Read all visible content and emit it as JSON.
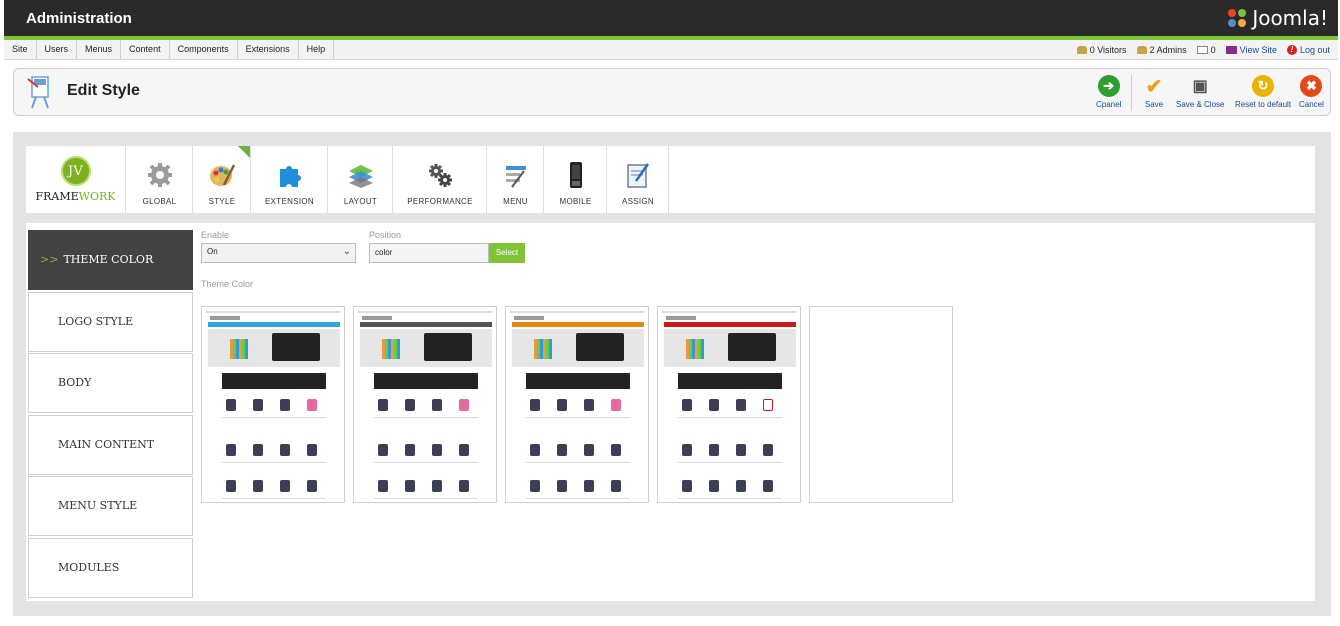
{
  "header": {
    "title": "Administration",
    "logo_text": "Joomla!"
  },
  "menubar": {
    "items": [
      "Site",
      "Users",
      "Menus",
      "Content",
      "Components",
      "Extensions",
      "Help"
    ],
    "status": {
      "visitors": "0 Visitors",
      "admins": "2 Admins",
      "messages": "0",
      "view_site": "View Site",
      "logout": "Log out"
    }
  },
  "toolbar": {
    "page_title": "Edit Style",
    "buttons": [
      {
        "label": "Cpanel",
        "icon": "back-arrow-icon",
        "color": "#2e9e2e"
      },
      {
        "label": "Save",
        "icon": "checkmark-icon",
        "color": "#f0a020"
      },
      {
        "label": "Save & Close",
        "icon": "floppy-disk-icon",
        "color": "#555555"
      },
      {
        "label": "Reset to default",
        "icon": "reset-icon",
        "color": "#e8b400"
      },
      {
        "label": "Cancel",
        "icon": "cancel-icon",
        "color": "#e24a1a"
      }
    ]
  },
  "framework": {
    "badge": "JV",
    "text_a": "FRAME",
    "text_b": "WORK"
  },
  "tabs": [
    {
      "label": "GLOBAL",
      "icon": "gear-icon"
    },
    {
      "label": "STYLE",
      "icon": "palette-icon",
      "active": true
    },
    {
      "label": "EXTENSION",
      "icon": "puzzle-icon"
    },
    {
      "label": "LAYOUT",
      "icon": "layers-icon"
    },
    {
      "label": "PERFORMANCE",
      "icon": "gears-icon"
    },
    {
      "label": "MENU",
      "icon": "menu-icon"
    },
    {
      "label": "MOBILE",
      "icon": "mobile-phone-icon"
    },
    {
      "label": "ASSIGN",
      "icon": "assign-icon"
    }
  ],
  "sidebar": {
    "items": [
      "THEME COLOR",
      "LOGO STYLE",
      "BODY",
      "MAIN CONTENT",
      "MENU STYLE",
      "MODULES"
    ],
    "active_marker": ">>"
  },
  "form": {
    "enable_label": "Enable",
    "enable_value": "On",
    "position_label": "Position",
    "position_value": "color",
    "select_button": "Select",
    "theme_color_label": "Theme Color"
  },
  "theme_thumbnails": {
    "nav_colors": [
      "#29a8dc",
      "#555555",
      "#e88a12",
      "#c81c1c"
    ],
    "empty_slot": true
  },
  "colors": {
    "accent_green": "#80c435",
    "dark_header": "#2a2a2a"
  }
}
